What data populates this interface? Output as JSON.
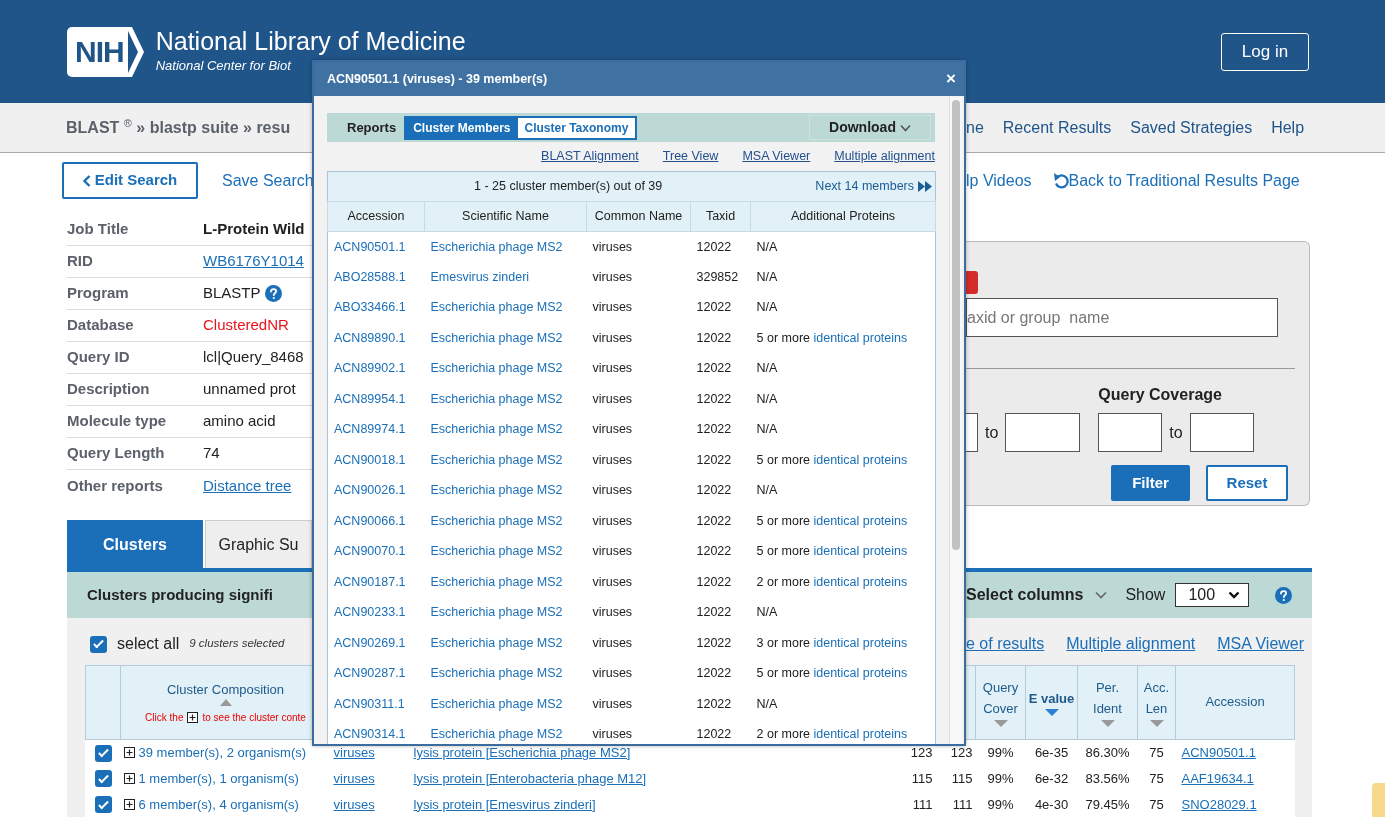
{
  "header": {
    "logo": "NIH",
    "title": "National Library of Medicine",
    "subtitle": "National Center for Biot",
    "login": "Log in"
  },
  "nav": {
    "breadcrumb": "BLAST $^{®}$ » blastp suite » resu",
    "links": [
      "ne",
      "Recent Results",
      "Saved Strategies",
      "Help"
    ]
  },
  "actions": {
    "edit_search": "Edit Search",
    "save_search": "Save Search",
    "right_links": [
      {
        "label": "lp Videos",
        "kind": "plain"
      },
      {
        "label": "Back to Traditional Results Page",
        "kind": "back"
      }
    ]
  },
  "summary": [
    {
      "label": "Job Title",
      "value": "L-Protein Wild",
      "kind": "bold"
    },
    {
      "label": "RID",
      "value": "WB6176Y1014",
      "kind": "link"
    },
    {
      "label": "Program",
      "value": "BLASTP",
      "kind": "help"
    },
    {
      "label": "Database",
      "value": "ClusteredNR",
      "kind": "red"
    },
    {
      "label": "Query ID",
      "value": "lcl|Query_8468",
      "kind": "plain"
    },
    {
      "label": "Description",
      "value": "unnamed prot",
      "kind": "plain"
    },
    {
      "label": "Molecule type",
      "value": "amino acid",
      "kind": "plain"
    },
    {
      "label": "Query Length",
      "value": "74",
      "kind": "plain"
    },
    {
      "label": "Other reports",
      "value": "Distance tree",
      "kind": "link"
    }
  ],
  "filter": {
    "search_placeholder": "axid or group  name",
    "range_joiner": "to",
    "coverage_title": "Query Coverage",
    "coverage_joiner": "to",
    "buttons": [
      {
        "label": "Filter",
        "kind": "primary"
      },
      {
        "label": "Reset",
        "kind": "outline"
      }
    ]
  },
  "tabs": [
    {
      "label": "Clusters",
      "selected": true
    },
    {
      "label": "Graphic Su",
      "selected": false
    }
  ],
  "results_bar": {
    "title": "Clusters producing signifi",
    "select_columns": "Select columns",
    "show_label": "Show",
    "show_value": "100"
  },
  "selection": {
    "label": "select all",
    "checked": true,
    "count": "9 clusters selected"
  },
  "result_links": [
    "e of results",
    "Multiple alignment",
    "MSA Viewer"
  ],
  "table": {
    "composition_header": "Cluster Composition",
    "hint_before": "Click the",
    "hint_after": "to see the cluster conte",
    "columns": [
      {
        "label": "Query Cover",
        "selected": false
      },
      {
        "label": "E value",
        "selected": true
      },
      {
        "label": "Per. Ident",
        "selected": false
      },
      {
        "label": "Acc. Len",
        "selected": false
      },
      {
        "label": "Accession"
      }
    ],
    "rows": [
      {
        "checked": true,
        "composition": "39 member(s), 2 organism(s)",
        "common_name": "viruses",
        "description": "lysis protein [Escherichia phage MS2]",
        "max_score": "123",
        "total_score": "123",
        "query_cover": "99%",
        "e_value": "6e-35",
        "per_ident": "86.30%",
        "acc_len": "75",
        "accession": "ACN90501.1"
      },
      {
        "checked": true,
        "composition": "1 member(s), 1 organism(s)",
        "common_name": "viruses",
        "description": "lysis protein [Enterobacteria phage M12]",
        "max_score": "115",
        "total_score": "115",
        "query_cover": "99%",
        "e_value": "6e-32",
        "per_ident": "83.56%",
        "acc_len": "75",
        "accession": "AAF19634.1"
      },
      {
        "checked": true,
        "composition": "6 member(s), 4 organism(s)",
        "common_name": "viruses",
        "description": "lysis protein [Emesvirus zinderi]",
        "max_score": "111",
        "total_score": "111",
        "query_cover": "99%",
        "e_value": "4e-30",
        "per_ident": "79.45%",
        "acc_len": "75",
        "accession": "SNO28029.1"
      }
    ]
  },
  "modal": {
    "title": "ACN90501.1 (viruses) - 39 member(s)",
    "close": "×",
    "reports_label": "Reports",
    "report_tabs": [
      {
        "label": "Cluster Members",
        "selected": true
      },
      {
        "label": "Cluster Taxonomy",
        "selected": false
      }
    ],
    "download": "Download",
    "links": [
      "BLAST Alignment",
      "Tree View",
      "MSA Viewer",
      "Multiple alignment"
    ],
    "pager": "1 - 25 cluster member(s) out of 39",
    "next": "Next 14 members",
    "columns": [
      "Accession",
      "Scientific Name",
      "Common Name",
      "Taxid",
      "Additional Proteins"
    ],
    "members": [
      {
        "accession": "ACN90501.1",
        "scientific_name": "Escherichia phage MS2",
        "common_name": "viruses",
        "taxid": "12022",
        "additional": "N/A"
      },
      {
        "accession": "ABO28588.1",
        "scientific_name": "Emesvirus zinderi",
        "common_name": "viruses",
        "taxid": "329852",
        "additional": "N/A"
      },
      {
        "accession": "ABO33466.1",
        "scientific_name": "Escherichia phage MS2",
        "common_name": "viruses",
        "taxid": "12022",
        "additional": "N/A"
      },
      {
        "accession": "ACN89890.1",
        "scientific_name": "Escherichia phage MS2",
        "common_name": "viruses",
        "taxid": "12022",
        "additional": "5 or more",
        "additional_link": "identical proteins"
      },
      {
        "accession": "ACN89902.1",
        "scientific_name": "Escherichia phage MS2",
        "common_name": "viruses",
        "taxid": "12022",
        "additional": "N/A"
      },
      {
        "accession": "ACN89954.1",
        "scientific_name": "Escherichia phage MS2",
        "common_name": "viruses",
        "taxid": "12022",
        "additional": "N/A"
      },
      {
        "accession": "ACN89974.1",
        "scientific_name": "Escherichia phage MS2",
        "common_name": "viruses",
        "taxid": "12022",
        "additional": "N/A"
      },
      {
        "accession": "ACN90018.1",
        "scientific_name": "Escherichia phage MS2",
        "common_name": "viruses",
        "taxid": "12022",
        "additional": "5 or more",
        "additional_link": "identical proteins"
      },
      {
        "accession": "ACN90026.1",
        "scientific_name": "Escherichia phage MS2",
        "common_name": "viruses",
        "taxid": "12022",
        "additional": "N/A"
      },
      {
        "accession": "ACN90066.1",
        "scientific_name": "Escherichia phage MS2",
        "common_name": "viruses",
        "taxid": "12022",
        "additional": "5 or more",
        "additional_link": "identical proteins"
      },
      {
        "accession": "ACN90070.1",
        "scientific_name": "Escherichia phage MS2",
        "common_name": "viruses",
        "taxid": "12022",
        "additional": "5 or more",
        "additional_link": "identical proteins"
      },
      {
        "accession": "ACN90187.1",
        "scientific_name": "Escherichia phage MS2",
        "common_name": "viruses",
        "taxid": "12022",
        "additional": "2 or more",
        "additional_link": "identical proteins"
      },
      {
        "accession": "ACN90233.1",
        "scientific_name": "Escherichia phage MS2",
        "common_name": "viruses",
        "taxid": "12022",
        "additional": "N/A"
      },
      {
        "accession": "ACN90269.1",
        "scientific_name": "Escherichia phage MS2",
        "common_name": "viruses",
        "taxid": "12022",
        "additional": "3 or more",
        "additional_link": "identical proteins"
      },
      {
        "accession": "ACN90287.1",
        "scientific_name": "Escherichia phage MS2",
        "common_name": "viruses",
        "taxid": "12022",
        "additional": "5 or more",
        "additional_link": "identical proteins"
      },
      {
        "accession": "ACN90311.1",
        "scientific_name": "Escherichia phage MS2",
        "common_name": "viruses",
        "taxid": "12022",
        "additional": "N/A"
      },
      {
        "accession": "ACN90314.1",
        "scientific_name": "Escherichia phage MS2",
        "common_name": "viruses",
        "taxid": "12022",
        "additional": "2 or more",
        "additional_link": "identical proteins"
      }
    ]
  }
}
